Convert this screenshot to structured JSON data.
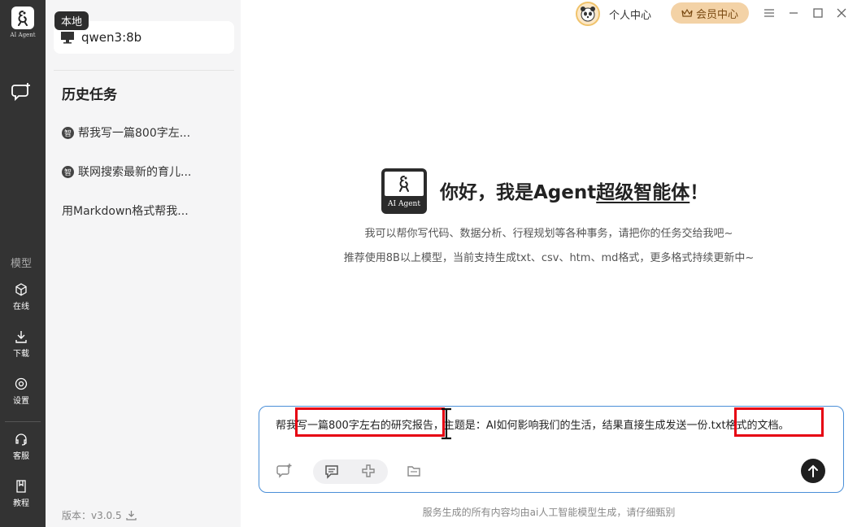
{
  "rail": {
    "logo_text": "AI Agent",
    "section_label": "模型",
    "items": [
      {
        "label": "在线",
        "icon": "cube-icon"
      },
      {
        "label": "下载",
        "icon": "download-icon"
      },
      {
        "label": "设置",
        "icon": "settings-icon"
      },
      {
        "label": "客服",
        "icon": "headset-icon"
      },
      {
        "label": "教程",
        "icon": "book-icon"
      }
    ]
  },
  "sidebar": {
    "local_tag": "本地",
    "model_name": "qwen3:8b",
    "history_title": "历史任务",
    "tasks": [
      {
        "label": "帮我写一篇800字左...",
        "badge": "智"
      },
      {
        "label": "联网搜索最新的育儿...",
        "badge": "智"
      },
      {
        "label": "用Markdown格式帮我..."
      }
    ],
    "version": "版本：v3.0.5"
  },
  "topbar": {
    "user_center": "个人中心",
    "member_center": "会员中心"
  },
  "hero": {
    "logo_text": "AI Agent",
    "title_prefix": "你好，我是Agent",
    "title_underlined": "超级智能体",
    "title_suffix": "！",
    "line1": "我可以帮你写代码、数据分析、行程规划等各种事务，请把你的任务交给我吧~",
    "line2": "推荐使用8B以上模型，当前支持生成txt、csv、htm、md格式，更多格式持续更新中~"
  },
  "input": {
    "value": "帮我写一篇800字左右的研究报告，主题是：AI如何影响我们的生活，结果直接生成发送一份.txt格式的文档。"
  },
  "footer": {
    "note": "服务生成的所有内容均由ai人工智能模型生成，请仔细甄别"
  },
  "colors": {
    "rail_bg": "#333333",
    "sidebar_bg": "#f5f5f6",
    "input_border": "#4a8fd8",
    "highlight_box": "#e60012",
    "member_btn": "#f3d2a6"
  }
}
